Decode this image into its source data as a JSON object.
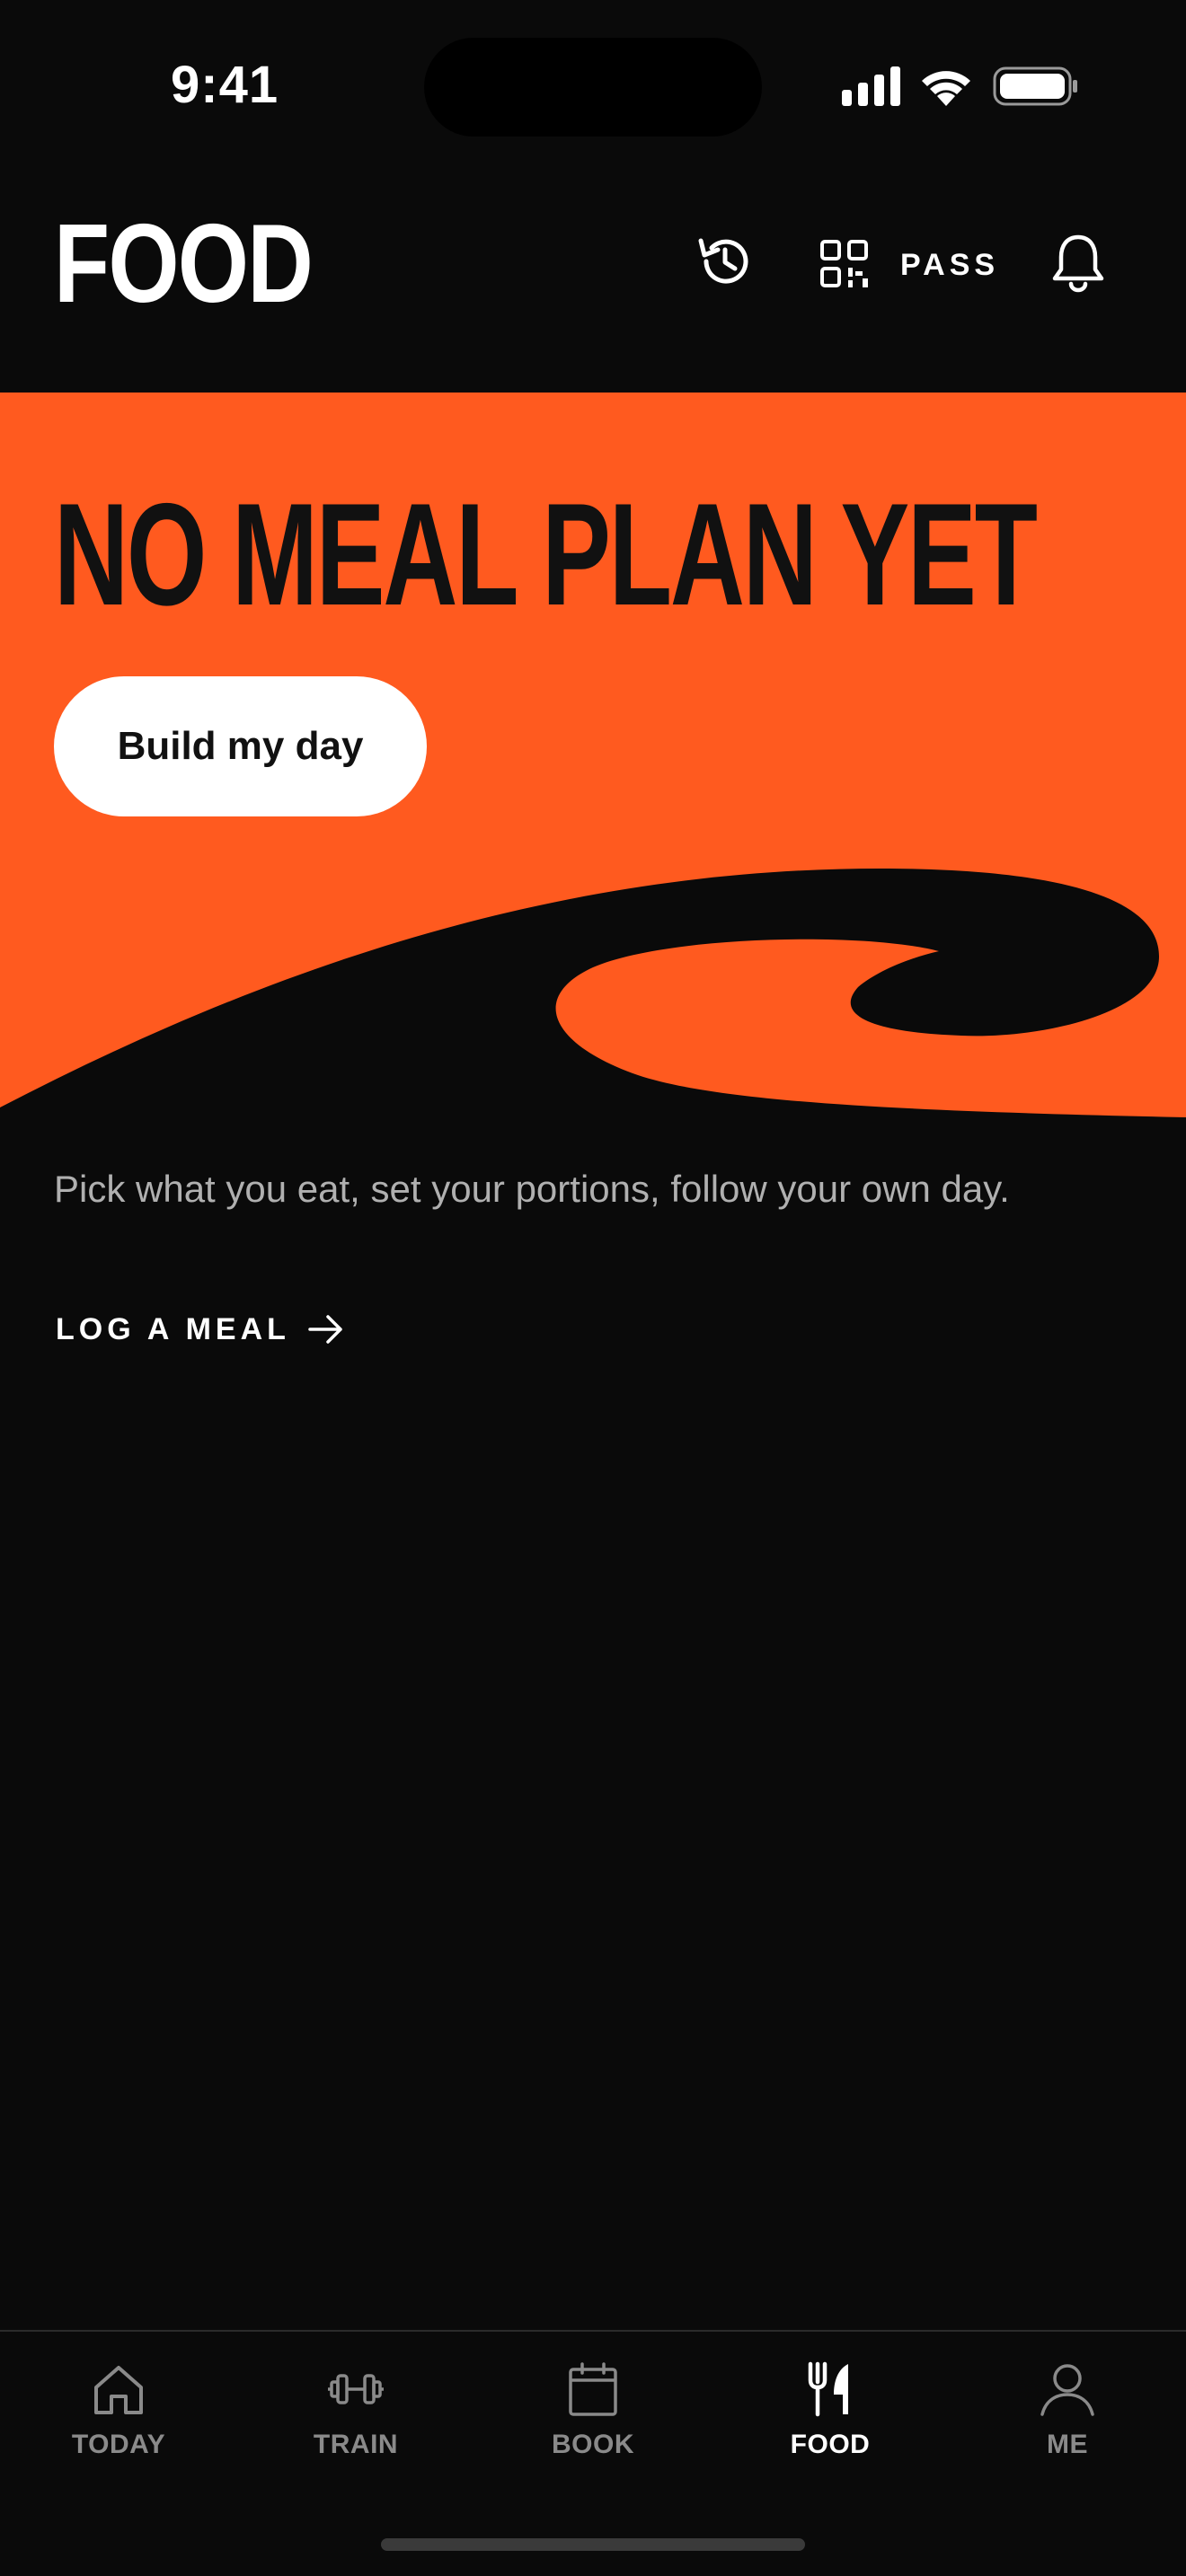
{
  "status_bar": {
    "time": "9:41"
  },
  "header": {
    "title": "FOOD",
    "pass_label": "PASS",
    "icons": [
      "history-icon",
      "qr-code-icon",
      "bell-icon"
    ]
  },
  "hero": {
    "title": "NO MEAL PLAN YET",
    "button_label": "Build my day",
    "background_color": "#ff5a1f"
  },
  "subtitle": "Pick what you eat, set your portions, follow your own day.",
  "log_meal": {
    "label": "LOG A MEAL"
  },
  "tab_bar": {
    "tabs": [
      {
        "label": "TODAY",
        "icon": "home-icon",
        "active": false
      },
      {
        "label": "TRAIN",
        "icon": "dumbbell-icon",
        "active": false
      },
      {
        "label": "BOOK",
        "icon": "calendar-icon",
        "active": false
      },
      {
        "label": "FOOD",
        "icon": "fork-knife-icon",
        "active": true
      },
      {
        "label": "ME",
        "icon": "person-icon",
        "active": false
      }
    ]
  },
  "colors": {
    "accent": "#ff5a1f",
    "background": "#0a0a0a",
    "text": "#ffffff",
    "muted": "#8a8a8a"
  }
}
